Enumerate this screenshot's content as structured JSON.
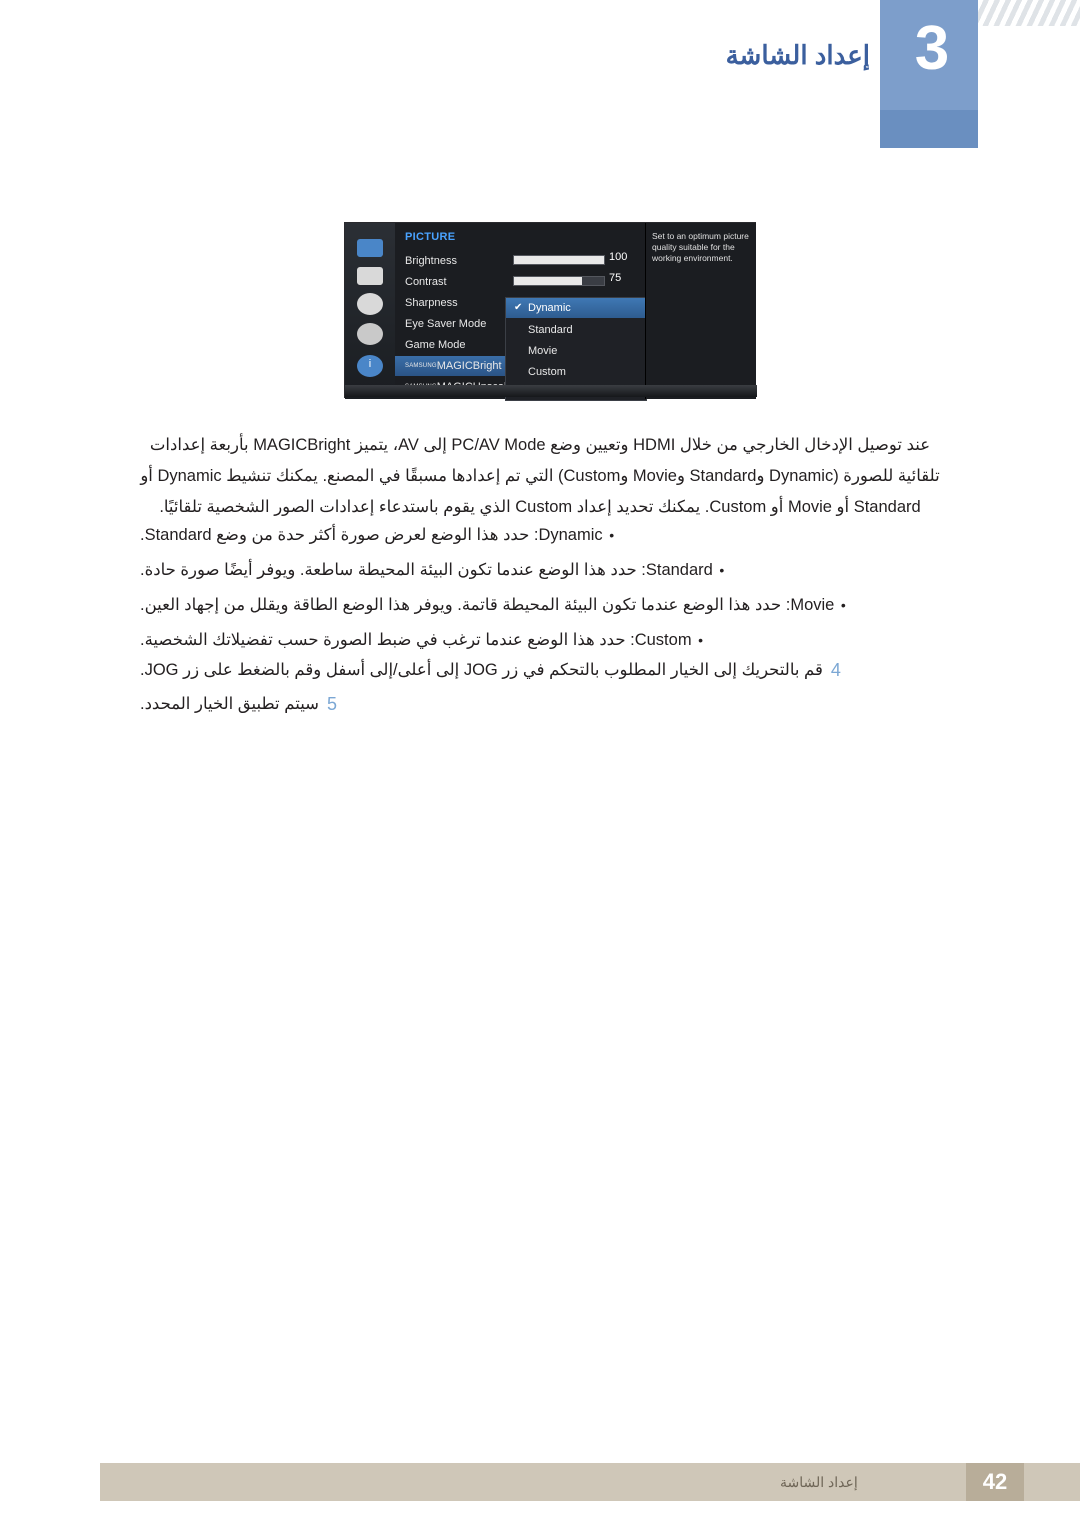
{
  "header": {
    "chapter_number": "3",
    "chapter_title": "إعداد الشاشة"
  },
  "osd": {
    "menu_title": "PICTURE",
    "sidebar_icons": [
      "monitor-icon",
      "menu-icon",
      "input-icon",
      "settings-icon",
      "information-icon"
    ],
    "rows": [
      {
        "label": "Brightness",
        "value": "100"
      },
      {
        "label": "Contrast",
        "value": "75"
      },
      {
        "label": "Sharpness",
        "value": ""
      },
      {
        "label": "Eye Saver Mode",
        "value": ""
      },
      {
        "label": "Game Mode",
        "value": ""
      },
      {
        "label": "MAGICBright",
        "brand": "SAMSUNG",
        "value": ""
      },
      {
        "label": "MAGICUpscale",
        "brand": "SAMSUNG",
        "value": ""
      }
    ],
    "popup_items": [
      "Dynamic",
      "Standard",
      "Movie",
      "Custom"
    ],
    "popup_selected": "Dynamic",
    "help_text": "Set to an optimum picture quality suitable for the working environment."
  },
  "body": {
    "paragraph_lines": [
      "عند توصيل الإدخال الخارجي من خلال HDMI وتعيين وضع PC/AV Mode إلى AV، يتميز MAGICBright بأربعة إعدادات",
      "تلقائية للصورة (Dynamic وStandard وMovie وCustom) التي تم إعدادها مسبقًا في المصنع. يمكنك تنشيط Dynamic أو",
      "Standard أو Movie أو Custom. يمكنك تحديد إعداد Custom الذي يقوم باستدعاء إعدادات الصور الشخصية تلقائيًا."
    ],
    "bullets": [
      "Dynamic: حدد هذا الوضع لعرض صورة أكثر حدة من وضع Standard.",
      "Standard: حدد هذا الوضع عندما تكون البيئة المحيطة ساطعة. ويوفر أيضًا صورة حادة.",
      "Movie: حدد هذا الوضع عندما تكون البيئة المحيطة قاتمة. ويوفر هذا الوضع الطاقة ويقلل من إجهاد العين.",
      "Custom: حدد هذا الوضع عندما ترغب في ضبط الصورة حسب تفضيلاتك الشخصية."
    ],
    "steps": [
      {
        "num": "4",
        "text": "قم بالتحريك إلى الخيار المطلوب بالتحكم في زر JOG إلى أعلى/إلى أسفل وقم بالضغط على زر JOG."
      },
      {
        "num": "5",
        "text": "سيتم تطبيق الخيار المحدد."
      }
    ]
  },
  "footer": {
    "text": "إعداد الشاشة",
    "page": "42"
  }
}
